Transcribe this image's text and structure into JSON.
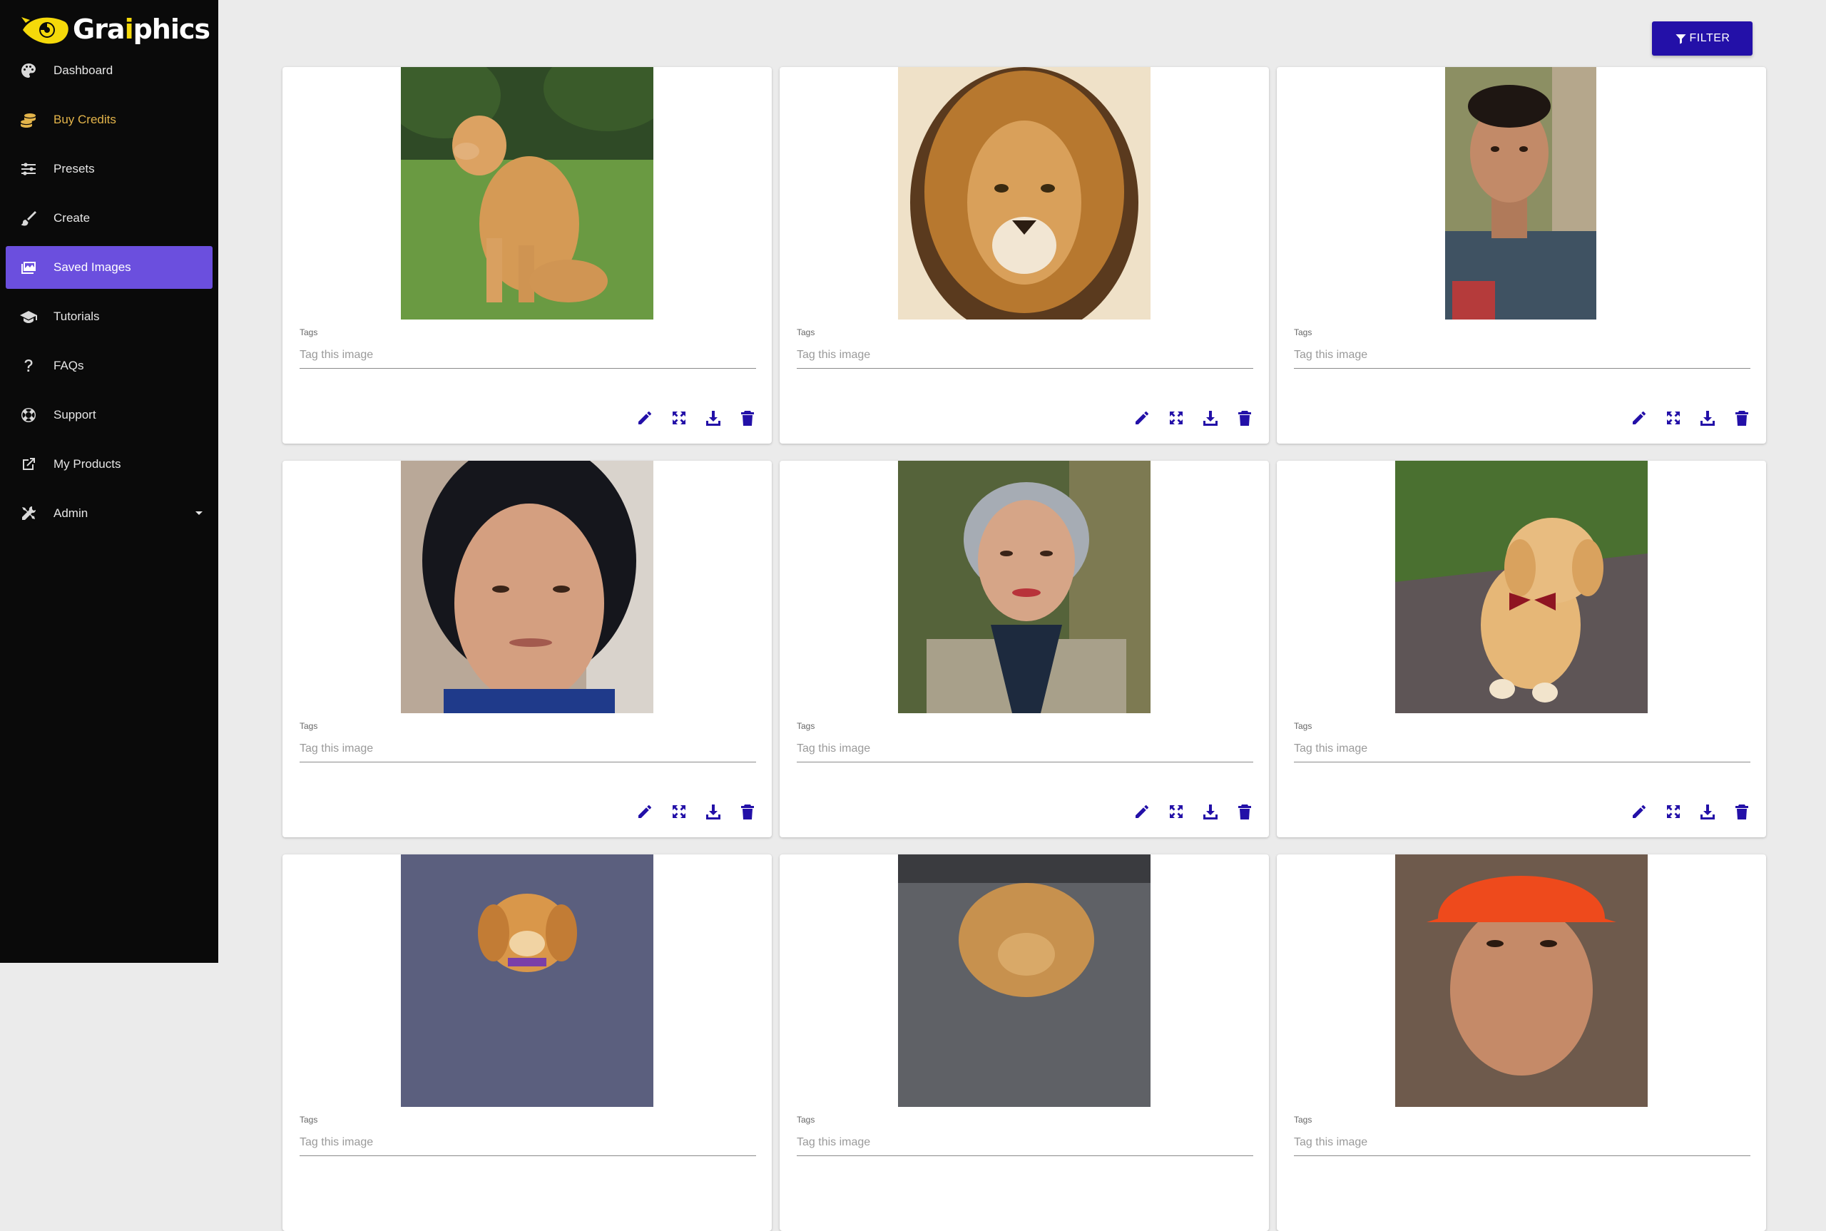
{
  "app": {
    "brand_prefix": "Gra",
    "brand_ai": "i",
    "brand_suffix": "phics"
  },
  "sidebar": {
    "items": [
      {
        "label": "Dashboard",
        "icon": "palette-icon"
      },
      {
        "label": "Buy Credits",
        "icon": "coins-icon",
        "color": "#e3b44a"
      },
      {
        "label": "Presets",
        "icon": "sliders-icon"
      },
      {
        "label": "Create",
        "icon": "brush-icon"
      },
      {
        "label": "Saved Images",
        "icon": "images-icon",
        "active": true
      },
      {
        "label": "Tutorials",
        "icon": "graduation-cap-icon"
      },
      {
        "label": "FAQs",
        "icon": "question-icon"
      },
      {
        "label": "Support",
        "icon": "lifebuoy-icon"
      },
      {
        "label": "My Products",
        "icon": "external-link-icon"
      },
      {
        "label": "Admin",
        "icon": "tools-icon",
        "has_dropdown": true
      }
    ]
  },
  "toolbar": {
    "filter_label": "FILTER"
  },
  "cards": [
    {
      "image": "golden retriever sitting on grass",
      "tags_label": "Tags",
      "placeholder": "Tag this image"
    },
    {
      "image": "lion portrait illustration",
      "tags_label": "Tags",
      "placeholder": "Tag this image"
    },
    {
      "image": "young man portrait",
      "tags_label": "Tags",
      "placeholder": "Tag this image"
    },
    {
      "image": "older woman portrait",
      "tags_label": "Tags",
      "placeholder": "Tag this image"
    },
    {
      "image": "elderly woman with scarf",
      "tags_label": "Tags",
      "placeholder": "Tag this image"
    },
    {
      "image": "golden puppy with bow tie",
      "tags_label": "Tags",
      "placeholder": "Tag this image"
    },
    {
      "image": "golden puppy",
      "tags_label": "Tags",
      "placeholder": "Tag this image"
    },
    {
      "image": "fluffy puppy on couch",
      "tags_label": "Tags",
      "placeholder": "Tag this image"
    },
    {
      "image": "man in orange hard hat",
      "tags_label": "Tags",
      "placeholder": "Tag this image"
    }
  ],
  "colors": {
    "accent": "#2310a8",
    "active_nav": "#6b4fde",
    "sidebar_bg": "#0a0a0a",
    "logo_yellow": "#f5d90a"
  }
}
